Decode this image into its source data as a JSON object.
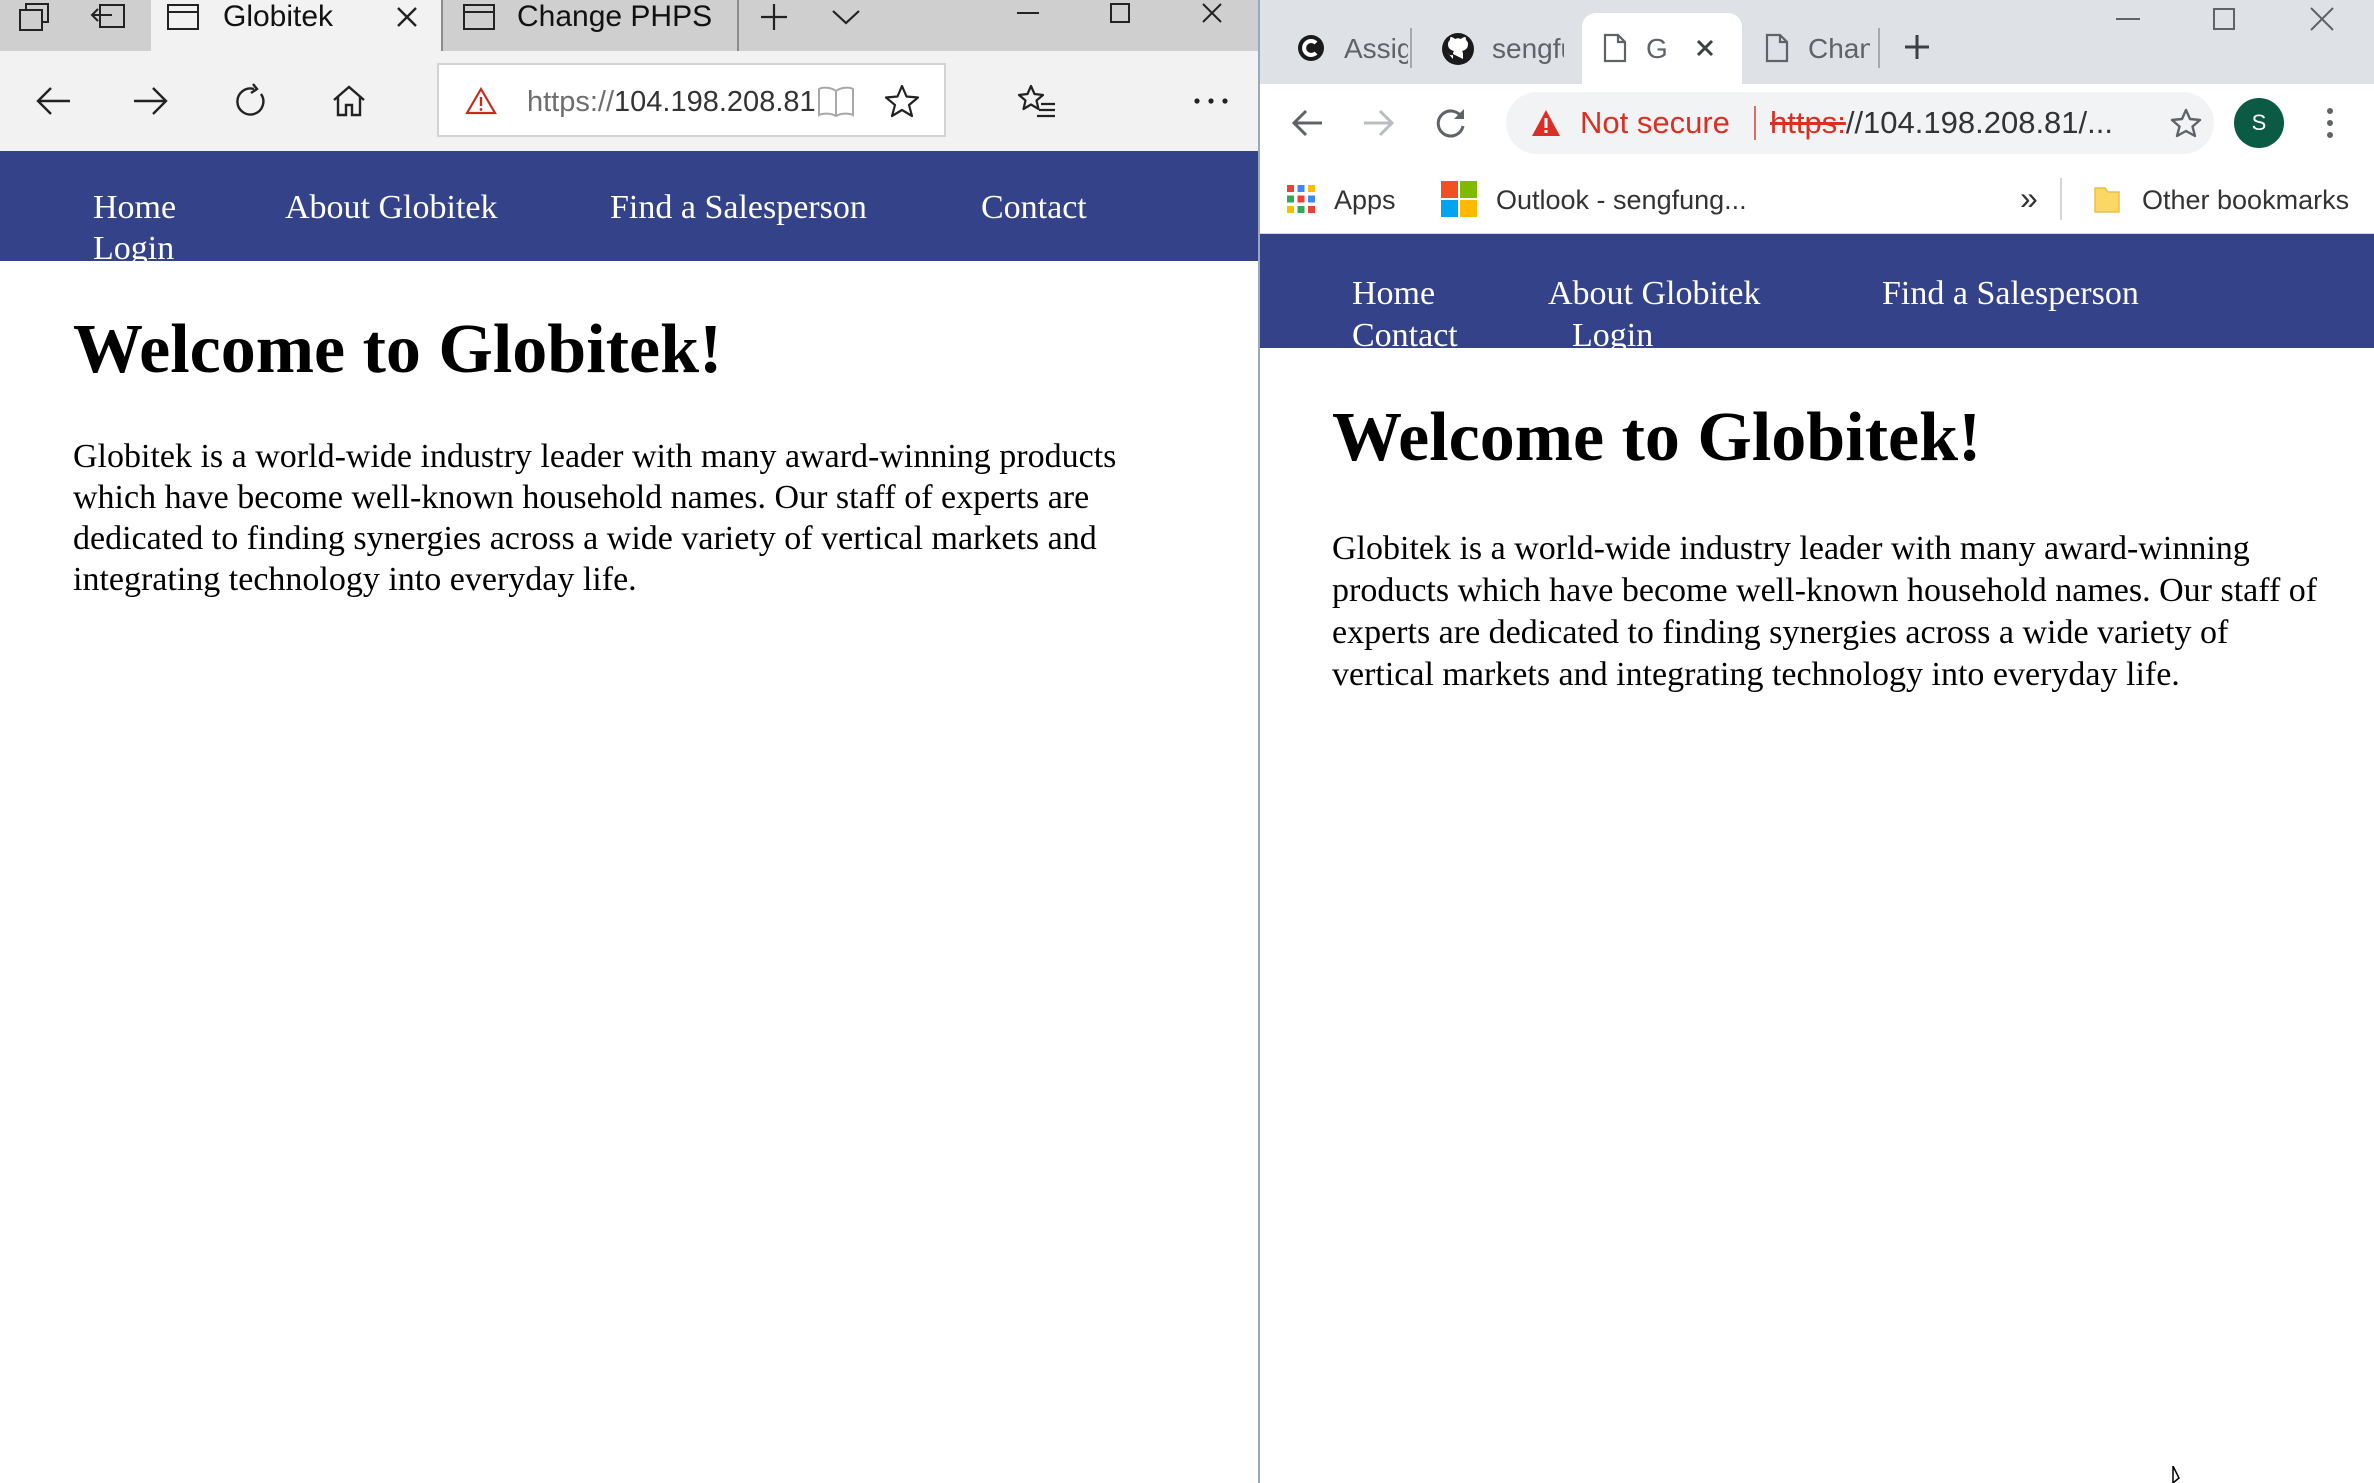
{
  "edge": {
    "tabs": [
      {
        "title": "Globitek"
      },
      {
        "title": "Change PHPSESSID"
      }
    ],
    "address": {
      "scheme": "https://",
      "host": "104.198.208.81"
    }
  },
  "chrome": {
    "tabs": [
      {
        "title": "Assignment"
      },
      {
        "title": "sengfung"
      },
      {
        "title": "Globitek"
      },
      {
        "title": "Change"
      }
    ],
    "profile_initial": "S",
    "security_label": "Not secure",
    "address": {
      "scheme": "https:",
      "rest": "//104.198.208.81/..."
    },
    "bookmarks": {
      "apps": "Apps",
      "outlook": "Outlook - sengfung...",
      "overflow": "»",
      "other": "Other bookmarks"
    }
  },
  "site": {
    "nav": {
      "home": "Home",
      "about": "About Globitek",
      "find": "Find a Salesperson",
      "contact": "Contact",
      "login": "Login"
    },
    "heading": "Welcome to Globitek!",
    "intro": "Globitek is a world-wide industry leader with many award-winning products which have become well-known household names. Our staff of experts are dedicated to finding synergies across a wide variety of vertical markets and integrating technology into everyday life."
  },
  "colors": {
    "nav_background": "#344389",
    "chrome_not_secure": "#d93025",
    "chrome_avatar": "#0b5a44"
  }
}
